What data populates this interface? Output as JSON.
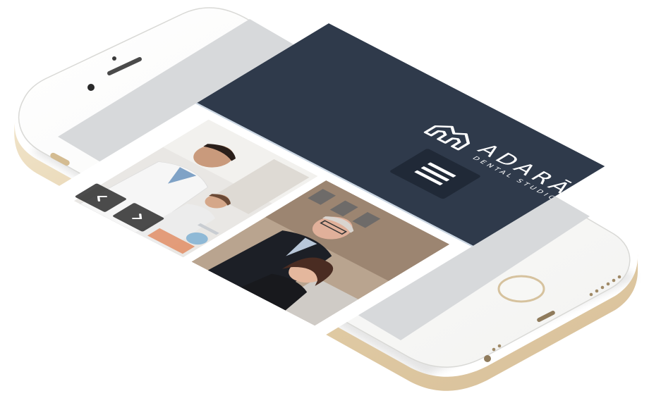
{
  "colors": {
    "header_bg": "#2f3a4b",
    "menu_button_bg": "#202937",
    "header_rule": "#c9d5e2",
    "phone_body": "#fbfbf9",
    "phone_frame_gold": "#e7d6b6",
    "screen_bezel": "#d7d9db"
  },
  "header": {
    "brand_name": "ADARĀ",
    "brand_tagline": "DENTAL STUDIO",
    "logo_icon": "house-tooth-logo-icon",
    "menu_icon": "hamburger-menu-icon"
  },
  "gallery": {
    "photos": [
      {
        "subject": "dentist-team-photo"
      },
      {
        "subject": "doctors-outdoor-photo"
      }
    ],
    "prev_icon": "chevron-left-icon",
    "next_icon": "chevron-right-icon"
  }
}
